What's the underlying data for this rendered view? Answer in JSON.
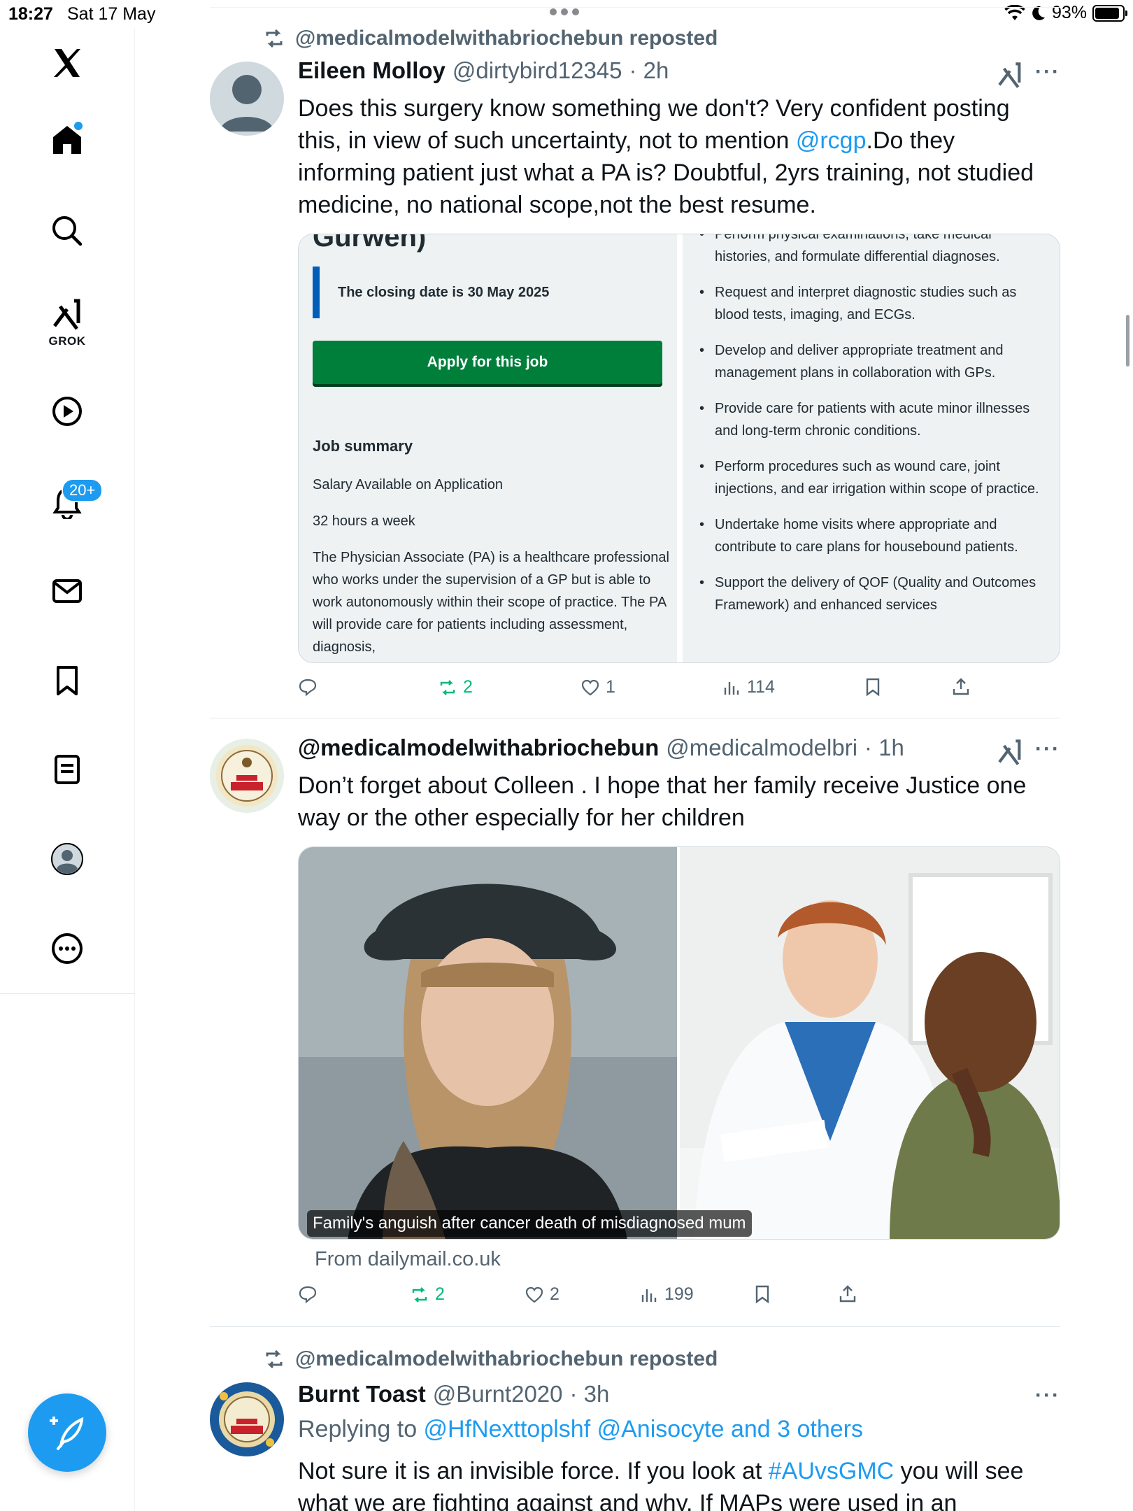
{
  "status_bar": {
    "time": "18:27",
    "date": "Sat 17 May",
    "battery": "93%"
  },
  "sidebar": {
    "items": [
      {
        "icon": "x-logo-icon"
      },
      {
        "icon": "home-icon"
      },
      {
        "icon": "search-icon"
      },
      {
        "icon": "grok-icon",
        "label": "GROK"
      },
      {
        "icon": "play-icon"
      },
      {
        "icon": "bell-icon",
        "badge": "20+"
      },
      {
        "icon": "mail-icon"
      },
      {
        "icon": "bookmark-icon"
      },
      {
        "icon": "list-icon"
      },
      {
        "icon": "profile-icon"
      },
      {
        "icon": "more-circle-icon"
      }
    ],
    "compose_icon": "compose-icon"
  },
  "tweets": [
    {
      "repost_by": "@medicalmodelwithabriochebun reposted",
      "name": "Eileen Molloy",
      "handle": "@dirtybird12345",
      "time": "· 2h",
      "text_before": "Does this surgery know something we don't? Very confident posting this, in view of such uncertainty, not to mention ",
      "mention": "@rcgp",
      "text_after": ".Do they informing patient just what a PA is? Doubtful, 2yrs training, not studied medicine, no national scope,not the best resume.",
      "job_card": {
        "cut_title": "Gurwen)",
        "closing": "The closing date is 30 May 2025",
        "apply": "Apply for this job",
        "summary_title": "Job summary",
        "salary": "Salary Available on Application",
        "hours": "32 hours a week",
        "description": "The Physician Associate (PA) is a healthcare professional who works under the supervision of a GP but is able to work autonomously within their scope of practice. The PA will provide care for patients including assessment, diagnosis,",
        "bullets": [
          "Perform physical examinations, take medical histories, and formulate differential diagnoses.",
          "Request and interpret diagnostic studies such as blood tests, imaging, and ECGs.",
          "Develop and deliver appropriate treatment and management plans in collaboration with GPs.",
          "Provide care for patients with acute minor illnesses and long-term chronic conditions.",
          "Perform procedures such as wound care, joint injections, and ear irrigation within scope of practice.",
          "Undertake home visits where appropriate and contribute to care plans for housebound patients.",
          "Support the delivery of QOF (Quality and Outcomes Framework) and enhanced services"
        ]
      },
      "stats": {
        "reposts": "2",
        "likes": "1",
        "views": "114"
      }
    },
    {
      "name": "@medicalmodelwithabriochebun",
      "handle": "@medicalmodelbri",
      "time": "· 1h",
      "text": "Don’t forget about Colleen . I hope that her family receive Justice one way or the other especially for her children",
      "media_caption": "Family's anguish after cancer death of misdiagnosed mum",
      "source": "From dailymail.co.uk",
      "stats": {
        "reposts": "2",
        "likes": "2",
        "views": "199"
      }
    },
    {
      "repost_by": "@medicalmodelwithabriochebun reposted",
      "name": "Burnt Toast",
      "handle": "@Burnt2020",
      "time": "· 3h",
      "replying_prefix": "Replying to ",
      "replying_to": "@HfNexttoplshf @Anisocyte and 3 others",
      "text_before": "Not sure it is an invisible force. If you look at ",
      "hashtag": "#AUvsGMC",
      "text_after": " you will see what we are fighting against and why. If MAPs were used in an assistant"
    }
  ]
}
